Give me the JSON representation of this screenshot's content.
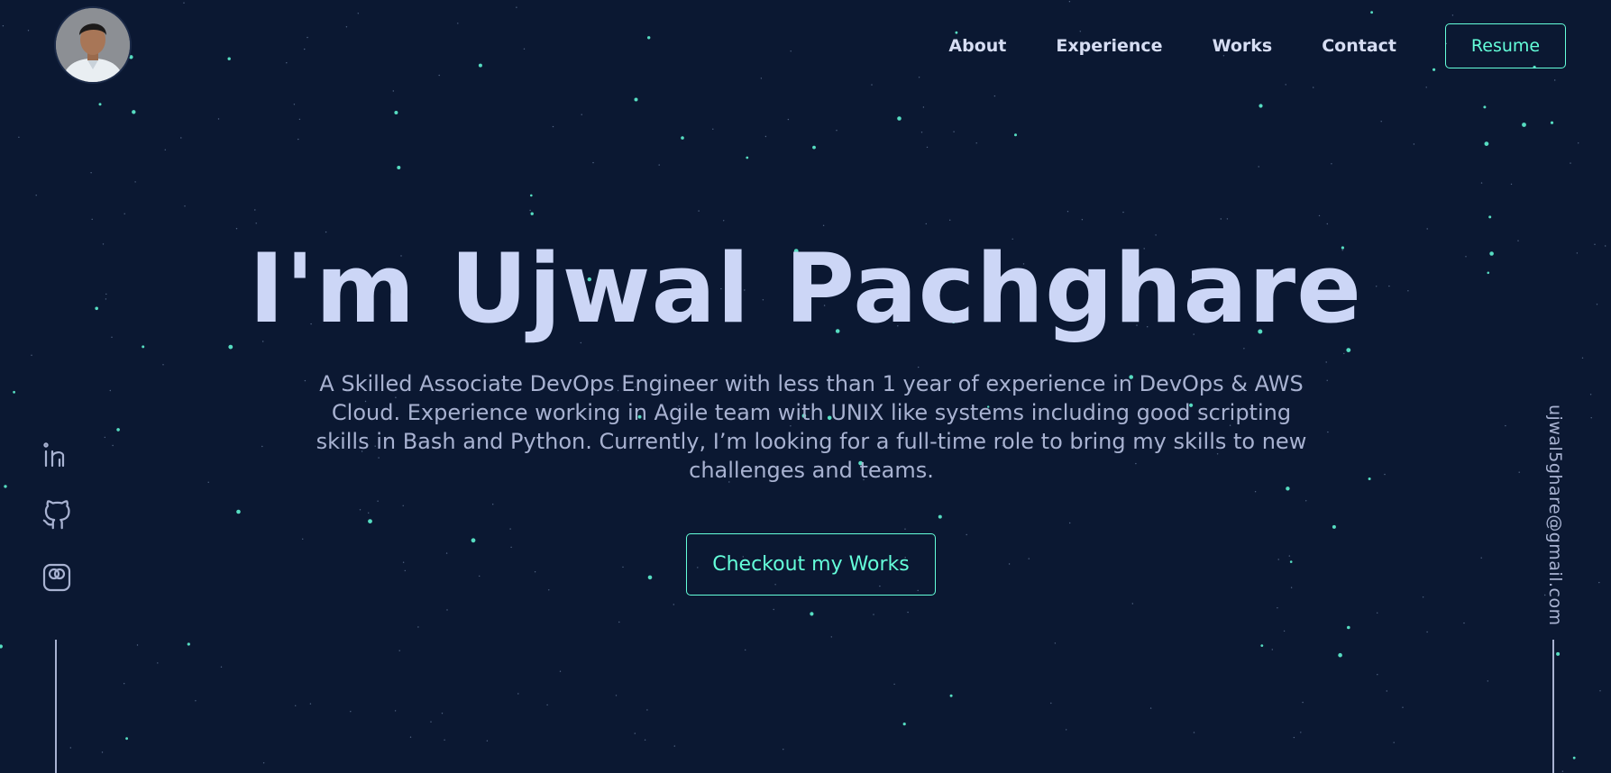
{
  "header": {
    "nav": [
      {
        "label": "About"
      },
      {
        "label": "Experience"
      },
      {
        "label": "Works"
      },
      {
        "label": "Contact"
      }
    ],
    "resume_label": "Resume"
  },
  "hero": {
    "title": "I'm Ujwal Pachghare",
    "description": "A Skilled Associate DevOps Engineer with less than 1 year of experience in DevOps & AWS Cloud. Experience working in Agile team with UNIX like systems including good scripting skills in Bash and Python. Currently, I’m looking for a full-time role to bring my skills to new challenges and teams.",
    "cta_label": "Checkout my Works"
  },
  "sidebar": {
    "social_icons": [
      "linkedin-icon",
      "github-icon",
      "instagram-icon"
    ]
  },
  "email": "ujwal5ghare@gmail.com",
  "colors": {
    "background": "#0b1832",
    "accent": "#64ffda",
    "heading": "#ccd6f6",
    "text": "#a8b2d1"
  }
}
